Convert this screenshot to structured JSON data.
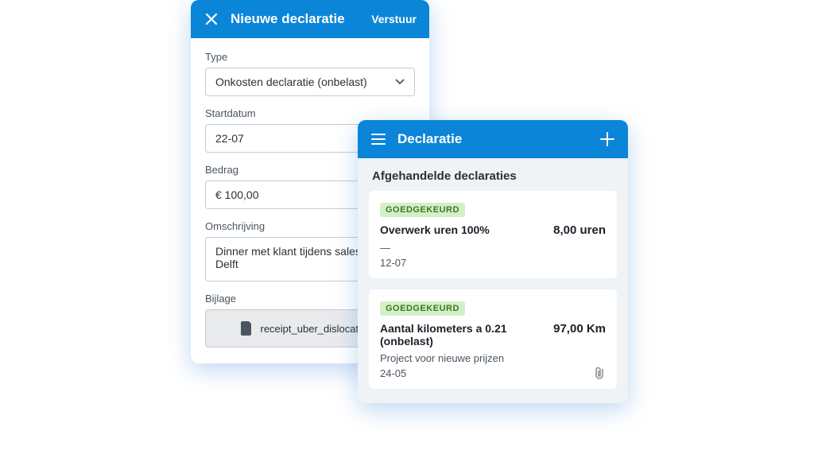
{
  "new_declaration": {
    "title": "Nieuwe declaratie",
    "submit_label": "Verstuur",
    "fields": {
      "type_label": "Type",
      "type_value": "Onkosten declaratie (onbelast)",
      "start_label": "Startdatum",
      "start_value": "22-07",
      "amount_label": "Bedrag",
      "amount_value": "€ 100,00",
      "description_label": "Omschrijving",
      "description_value": "Dinner met klant tijdens salestraject in Delft",
      "attachment_label": "Bijlage",
      "attachment_value": "receipt_uber_dislocation.pdf"
    }
  },
  "declaration_list": {
    "title": "Declaratie",
    "section_title": "Afgehandelde declaraties",
    "items": [
      {
        "status": "GOEDGEKEURD",
        "title": "Overwerk uren 100%",
        "amount": "8,00 uren",
        "subtitle": "—",
        "date": "12-07",
        "has_attachment": false
      },
      {
        "status": "GOEDGEKEURD",
        "title": "Aantal kilometers a 0.21 (onbelast)",
        "amount": "97,00 Km",
        "subtitle": "Project voor nieuwe prijzen",
        "date": "24-05",
        "has_attachment": true
      }
    ]
  }
}
